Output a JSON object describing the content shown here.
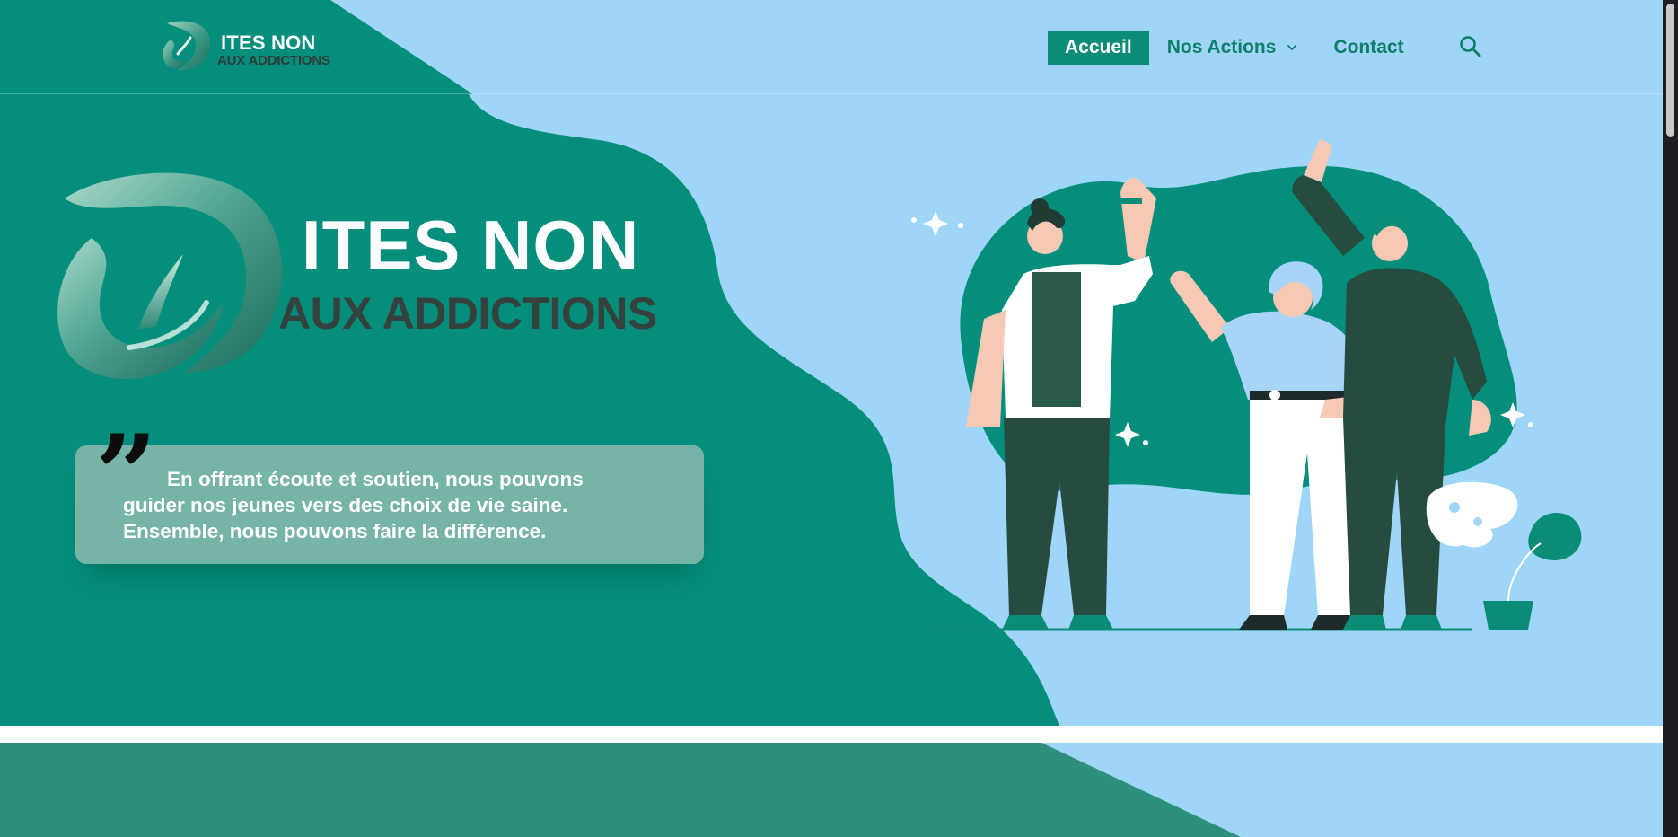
{
  "site": {
    "logo": {
      "line1": "ITES NON",
      "line2": "AUX ADDICTIONS"
    }
  },
  "nav": {
    "items": [
      {
        "label": "Accueil",
        "active": true
      },
      {
        "label": "Nos Actions",
        "has_dropdown": true
      },
      {
        "label": "Contact"
      }
    ],
    "search_icon": "search-icon"
  },
  "hero": {
    "title_line1": "ITES NON",
    "title_line2": "AUX ADDICTIONS",
    "quote": {
      "lines": [
        "En offrant écoute et soutien, nous pouvons",
        "guider nos jeunes vers des choix de vie saine.",
        "Ensemble, nous pouvons faire la différence."
      ]
    },
    "illustration": "three-people-high-five-illustration"
  },
  "colors": {
    "teal": "#048e7b",
    "sky": "#9fd6f8",
    "dark_green": "#274c40",
    "active_nav_bg": "#0a8c76"
  }
}
